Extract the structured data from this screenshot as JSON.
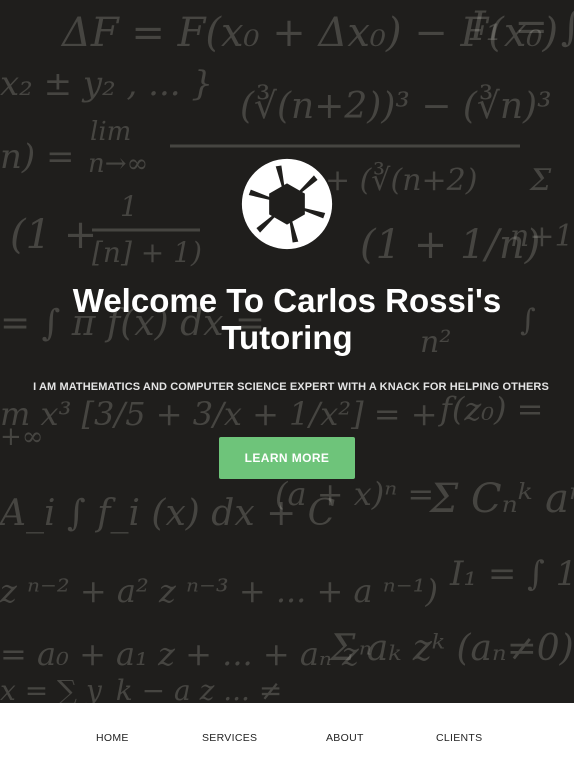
{
  "hero": {
    "title_line1": "Welcome To Carlos Rossi's",
    "title_line2": "Tutoring",
    "tagline": "I AM MATHEMATICS AND COMPUTER SCIENCE EXPERT WITH A KNACK FOR HELPING OTHERS",
    "cta_label": "LEARN MORE",
    "cta_color": "#6ec47a",
    "background_color": "#1f1e1c",
    "logo_icon": "aperture-icon"
  },
  "nav": {
    "items": [
      {
        "label": "HOME"
      },
      {
        "label": "SERVICES"
      },
      {
        "label": "ABOUT"
      },
      {
        "label": "CLIENTS"
      }
    ]
  }
}
